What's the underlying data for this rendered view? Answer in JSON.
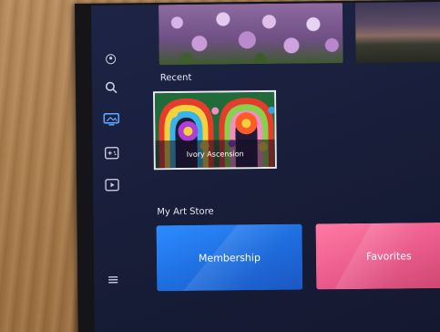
{
  "sidebar": {
    "icons": [
      "profile-icon",
      "search-icon",
      "art-mode-icon",
      "game-icon",
      "media-icon",
      "menu-icon"
    ],
    "active": "art-mode-icon"
  },
  "sections": {
    "recent_label": "Recent",
    "store_label": "My Art Store"
  },
  "recent": {
    "items": [
      {
        "title": "Ivory Ascension"
      }
    ]
  },
  "store": {
    "cards": [
      {
        "label": "Membership",
        "color": "#2d8cff"
      },
      {
        "label": "Favorites",
        "color": "#ea5c8c"
      }
    ]
  },
  "colors": {
    "screen_bg": "#1b2140",
    "accent": "#5ea7ff",
    "focus_border": "#e8e8ee"
  }
}
